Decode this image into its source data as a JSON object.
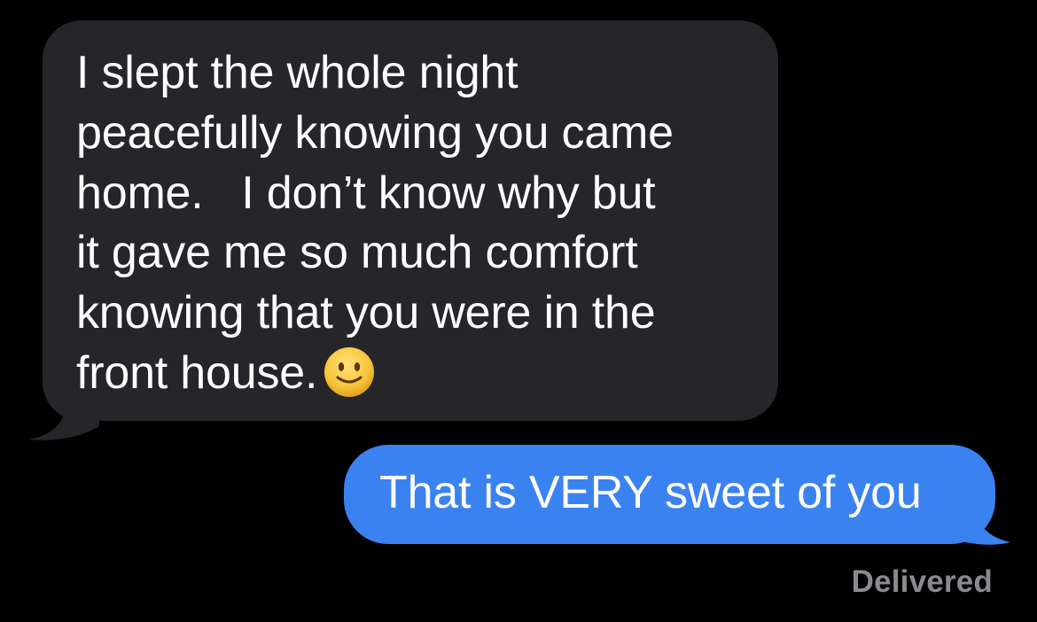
{
  "messages": {
    "incoming": {
      "lines": [
        "I slept the whole night",
        "peacefully knowing you came",
        "home.   I don’t know why but",
        "it gave me so much comfort",
        "knowing that you were in the",
        "front house."
      ],
      "emoji": "slightly-smiling-face",
      "bubble_color": "#26252a"
    },
    "outgoing": {
      "text": "That is VERY sweet of you",
      "bubble_color": "#3b82f1"
    },
    "status": "Delivered"
  },
  "colors": {
    "background": "#000000",
    "text": "#ffffff",
    "status_text": "#8a8a8f",
    "emoji_face": "#f7c43a"
  }
}
